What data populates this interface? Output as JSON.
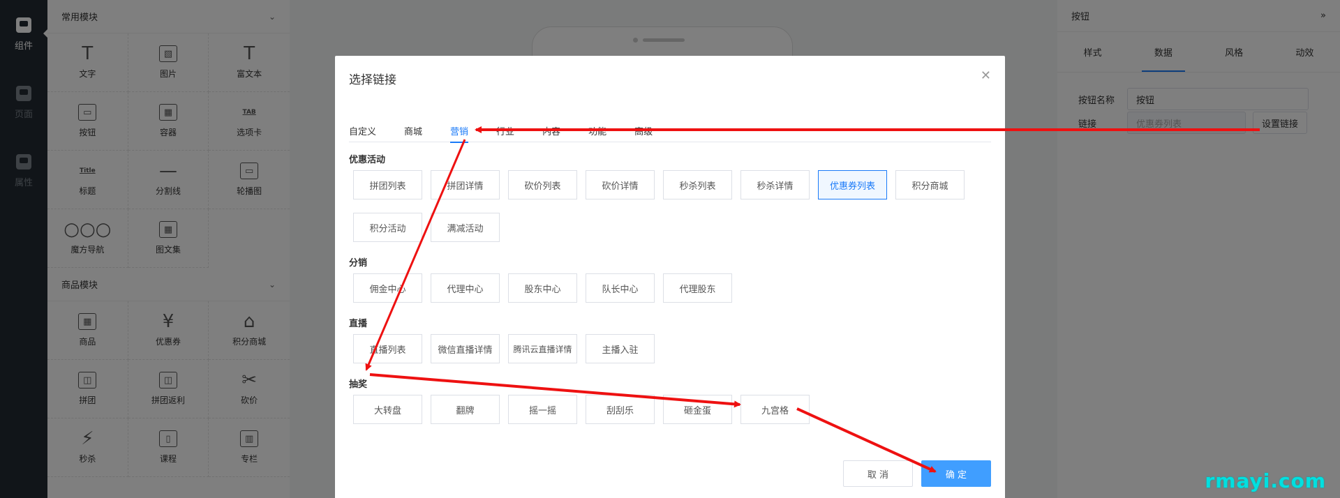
{
  "rail": {
    "items": [
      {
        "label": "组件",
        "active": true,
        "icon": "component-icon"
      },
      {
        "label": "页面",
        "active": false,
        "icon": "page-icon"
      },
      {
        "label": "属性",
        "active": false,
        "icon": "property-icon"
      }
    ]
  },
  "panel": {
    "sections": [
      {
        "title": "常用模块",
        "items": [
          {
            "label": "文字",
            "icon": "T"
          },
          {
            "label": "图片",
            "icon": "▧"
          },
          {
            "label": "富文本",
            "icon": "T"
          },
          {
            "label": "按钮",
            "icon": "▭"
          },
          {
            "label": "容器",
            "icon": "▦"
          },
          {
            "label": "选项卡",
            "icon": "TAB"
          },
          {
            "label": "标题",
            "icon": "Title"
          },
          {
            "label": "分割线",
            "icon": "—"
          },
          {
            "label": "轮播图",
            "icon": "▭"
          },
          {
            "label": "魔方导航",
            "icon": "○○○"
          },
          {
            "label": "图文集",
            "icon": "▦"
          }
        ]
      },
      {
        "title": "商品模块",
        "items": [
          {
            "label": "商品",
            "icon": "▦"
          },
          {
            "label": "优惠券",
            "icon": "¥"
          },
          {
            "label": "积分商城",
            "icon": "⌂"
          },
          {
            "label": "拼团",
            "icon": "◫"
          },
          {
            "label": "拼团返利",
            "icon": "◫"
          },
          {
            "label": "砍价",
            "icon": "✂"
          },
          {
            "label": "秒杀",
            "icon": "⚡"
          },
          {
            "label": "课程",
            "icon": "▯"
          },
          {
            "label": "专栏",
            "icon": "▥"
          }
        ]
      }
    ]
  },
  "props": {
    "title": "按钮",
    "tabs": [
      "样式",
      "数据",
      "风格",
      "动效"
    ],
    "active_tab": 1,
    "name_label": "按钮名称",
    "name_value": "按钮",
    "link_label": "链接",
    "link_placeholder": "优惠券列表",
    "set_link_button": "设置链接"
  },
  "dialog": {
    "title": "选择链接",
    "tabs": [
      "自定义",
      "商城",
      "营销",
      "行业",
      "内容",
      "功能",
      "高级"
    ],
    "active_tab": 2,
    "groups": [
      {
        "title": "优惠活动",
        "options": [
          "拼团列表",
          "拼团详情",
          "砍价列表",
          "砍价详情",
          "秒杀列表",
          "秒杀详情",
          "优惠券列表",
          "积分商城",
          "积分活动",
          "满减活动"
        ],
        "selected": 6
      },
      {
        "title": "分销",
        "options": [
          "佣金中心",
          "代理中心",
          "股东中心",
          "队长中心",
          "代理股东"
        ],
        "selected": -1
      },
      {
        "title": "直播",
        "options": [
          "直播列表",
          "微信直播详情",
          "腾讯云直播详情",
          "主播入驻"
        ],
        "selected": -1
      },
      {
        "title": "抽奖",
        "options": [
          "大转盘",
          "翻牌",
          "摇一摇",
          "刮刮乐",
          "砸金蛋",
          "九宫格"
        ],
        "selected": -1
      }
    ],
    "cancel_label": "取 消",
    "confirm_label": "确 定"
  },
  "watermark": "rmayi.com",
  "colors": {
    "accent": "#1a7af8",
    "primary_button": "#409eff",
    "arrow": "#ee1111",
    "rail": "#222a33"
  }
}
